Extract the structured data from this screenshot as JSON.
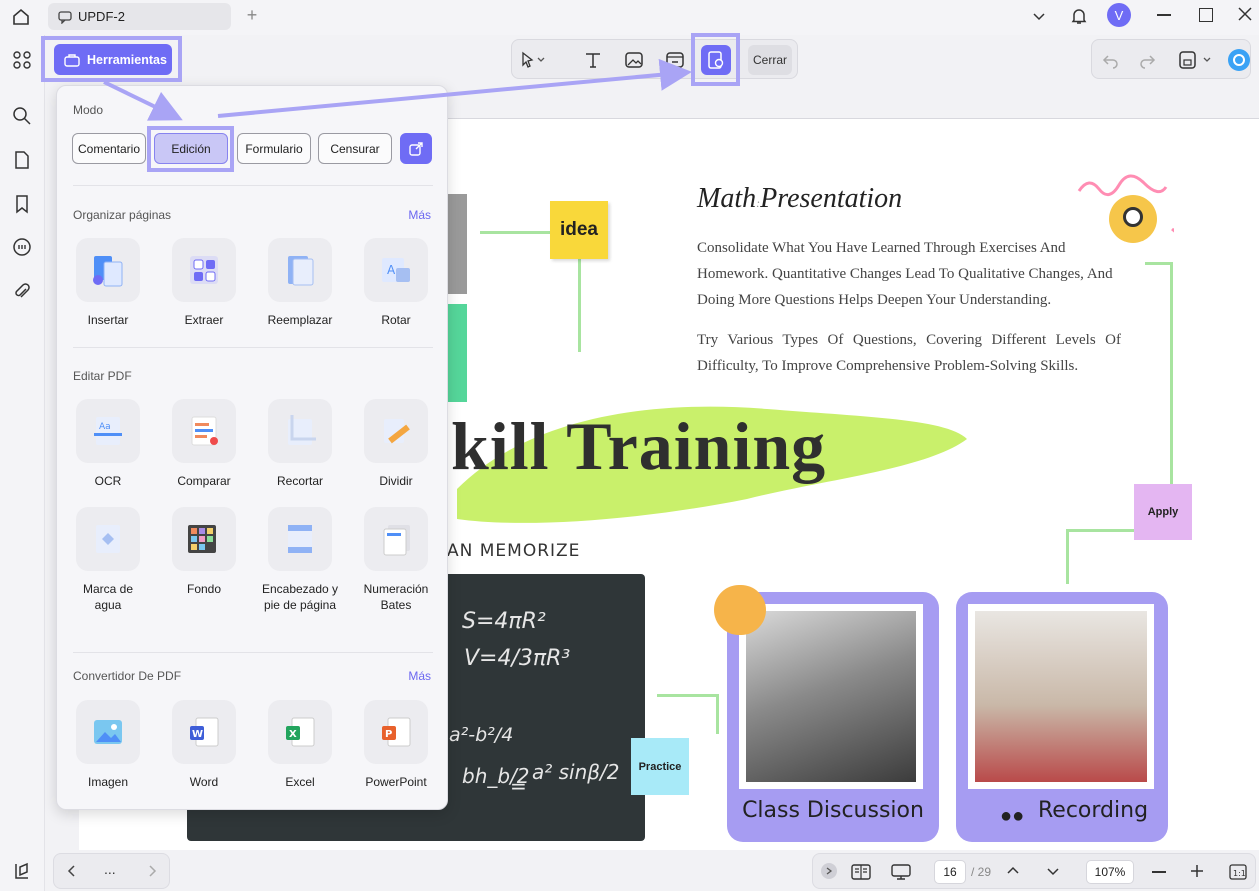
{
  "window": {
    "tab_title": "UPDF-2",
    "avatar_initial": "V"
  },
  "toolbar": {
    "close_label": "Cerrar",
    "tools_button_label": "Herramientas"
  },
  "panel": {
    "mode_title": "Modo",
    "modes": [
      "Comentario",
      "Edición",
      "Formulario",
      "Censurar"
    ],
    "selected_mode": "Edición",
    "organize": {
      "title": "Organizar páginas",
      "more": "Más",
      "items": [
        "Insertar",
        "Extraer",
        "Reemplazar",
        "Rotar"
      ]
    },
    "edit": {
      "title": "Editar PDF",
      "items": [
        "OCR",
        "Comparar",
        "Recortar",
        "Dividir",
        "Marca de agua",
        "Fondo",
        "Encabezado y pie de página",
        "Numeración Bates"
      ]
    },
    "convert": {
      "title": "Convertidor De PDF",
      "more": "Más",
      "items": [
        "Imagen",
        "Word",
        "Excel",
        "PowerPoint"
      ]
    }
  },
  "document": {
    "title_part1": "Math",
    "title_part2": "Presentation",
    "para1": "Consolidate What You Have Learned Through Exercises And Homework. Quantitative Changes Lead To Qualitative Changes, And Doing More Questions Helps Deepen Your Understanding.",
    "para2": "Try Various Types Of Questions, Covering Different Levels Of Difficulty, To Improve Comprehensive Problem-Solving Skills.",
    "idea_label": "idea",
    "headline": "kill Training",
    "memorize": "AN MEMORIZE",
    "apply_label": "Apply",
    "practice_label": "Practice",
    "card1_caption": "Class Discussion",
    "card2_caption": "Recording",
    "formulas": [
      "S=4πR²",
      "V=4/3πR³",
      "a²-b²/4",
      "bh_b/2",
      "=",
      "a² sinβ/2"
    ]
  },
  "footer": {
    "nav_dots": "...",
    "page_current": "16",
    "page_total": "/ 29",
    "zoom": "107%"
  },
  "colors": {
    "accent": "#6f6cf5",
    "highlight": "#a9a4f5",
    "green_note": "#c9f06b",
    "card_purple": "#a69cf2",
    "yellow_note": "#f9d83a"
  }
}
